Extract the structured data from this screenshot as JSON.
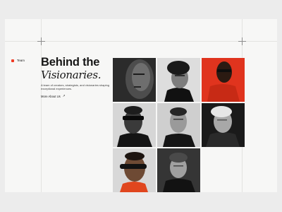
{
  "section": {
    "label": "Team"
  },
  "hero": {
    "title_line1": "Behind the",
    "title_line2": "Visionaries.",
    "description": "A team of creators, strategists, and visionaries shaping exceptional experiences.",
    "link_label": "More About Us",
    "link_arrow": "↗"
  },
  "colors": {
    "accent": "#ef3b24",
    "background": "#f7f7f6",
    "text": "#161616"
  },
  "portraits": [
    {
      "name": "portrait-man-bw-closeup",
      "bg": "#2a2a2a",
      "skin": "#5a5a5a",
      "tone": "bw"
    },
    {
      "name": "portrait-man-bw-curly-hair",
      "bg": "#dcdcdc",
      "skin": "#8a8a8a",
      "tone": "bw"
    },
    {
      "name": "portrait-man-red-background",
      "bg": "#e0341e",
      "skin": "#3a2418",
      "tone": "red"
    },
    {
      "name": "portrait-man-sunglasses-bw",
      "bg": "#d6d6d6",
      "skin": "#3c3c3c",
      "tone": "bw"
    },
    {
      "name": "portrait-man-bw-short-hair",
      "bg": "#c9c9c9",
      "skin": "#9a9a9a",
      "tone": "bw"
    },
    {
      "name": "portrait-older-man-bw",
      "bg": "#1a1a1a",
      "skin": "#b0b0b0",
      "tone": "bw"
    },
    {
      "name": "portrait-man-sunglasses-orange",
      "bg": "#d8d8d8",
      "skin": "#6e4a34",
      "tone": "color"
    },
    {
      "name": "portrait-young-man-bw",
      "bg": "#303030",
      "skin": "#9c9c9c",
      "tone": "bw"
    }
  ]
}
